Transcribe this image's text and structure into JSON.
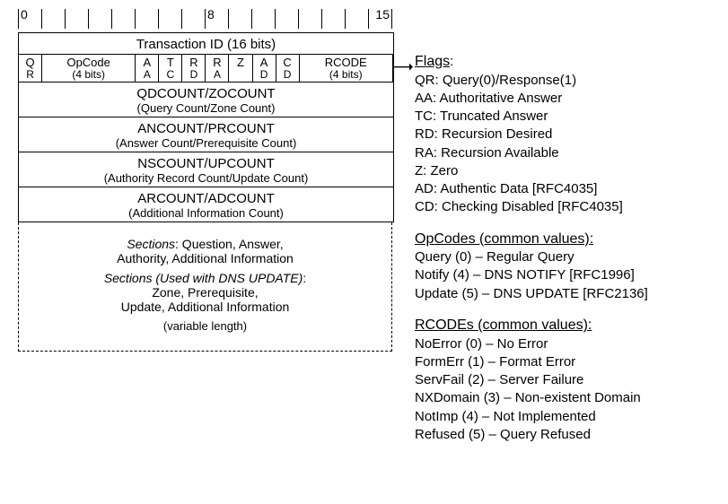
{
  "ruler": {
    "b0": "0",
    "b8": "8",
    "b15": "15"
  },
  "header": {
    "txid": "Transaction ID (16 bits)",
    "flags": {
      "qr1": "Q",
      "qr2": "R",
      "op1": "OpCode",
      "op2": "(4 bits)",
      "aa1": "A",
      "aa2": "A",
      "tc1": "T",
      "tc2": "C",
      "rd1": "R",
      "rd2": "D",
      "ra1": "R",
      "ra2": "A",
      "z1": "Z",
      "z2": "",
      "ad1": "A",
      "ad2": "D",
      "cd1": "C",
      "cd2": "D",
      "rc1": "RCODE",
      "rc2": "(4 bits)"
    },
    "qd1": "QDCOUNT/ZOCOUNT",
    "qd2": "(Query Count/Zone Count)",
    "an1": "ANCOUNT/PRCOUNT",
    "an2": "(Answer Count/Prerequisite Count)",
    "ns1": "NSCOUNT/UPCOUNT",
    "ns2": "(Authority Record Count/Update Count)",
    "ar1": "ARCOUNT/ADCOUNT",
    "ar2": "(Additional Information Count)"
  },
  "sections": {
    "s1a": "Sections",
    "s1b": ": Question, Answer,",
    "s1c": "Authority, Additional Information",
    "s2a": "Sections (Used with DNS UPDATE)",
    "s2b": ":",
    "s2c": "Zone, Prerequisite,",
    "s2d": "Update, Additional Information",
    "vl": "(variable length)"
  },
  "legend": {
    "flags_hdr": "Flags",
    "flags": {
      "qr": "QR: Query(0)/Response(1)",
      "aa": "AA: Authoritative Answer",
      "tc": "TC: Truncated Answer",
      "rd": "RD: Recursion Desired",
      "ra": "RA: Recursion Available",
      "z": "Z: Zero",
      "ad": "AD: Authentic Data [RFC4035]",
      "cd": "CD: Checking Disabled [RFC4035]"
    },
    "op_hdr": "OpCodes (common values):",
    "op": {
      "q": "Query (0) – Regular Query",
      "n": "Notify (4) – DNS NOTIFY [RFC1996]",
      "u": "Update (5) – DNS UPDATE [RFC2136]"
    },
    "rc_hdr": "RCODEs (common values):",
    "rc": {
      "noerr": "NoError (0) – No Error",
      "form": "FormErr (1) – Format Error",
      "serv": "ServFail (2) – Server Failure",
      "nx": "NXDomain (3) – Non-existent Domain",
      "notimp": "NotImp (4) – Not Implemented",
      "ref": "Refused (5) – Query Refused"
    }
  }
}
